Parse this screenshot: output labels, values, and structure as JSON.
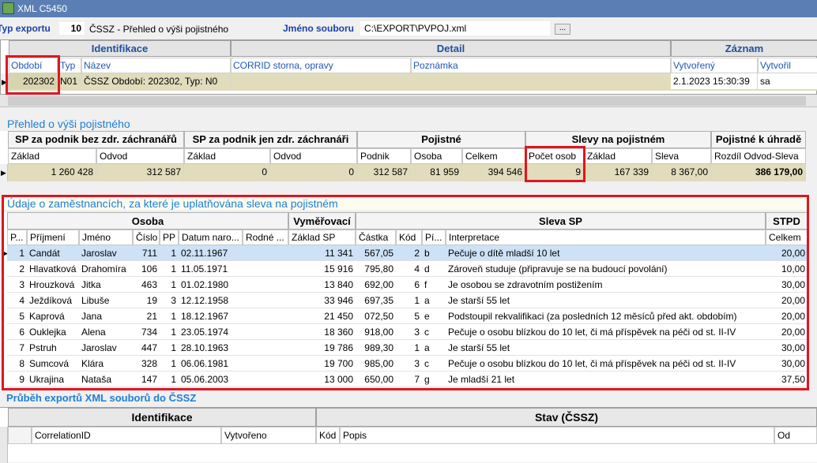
{
  "window": {
    "title": "XML C5450"
  },
  "toolbar": {
    "typ_label": "Typ exportu",
    "typ_value": "10",
    "typ_desc": "ČSSZ - Přehled o výši pojistného",
    "soubor_label": "Jméno souboru",
    "soubor_value": "C:\\EXPORT\\PVPOJ.xml",
    "browse_label": "..."
  },
  "grid1": {
    "bands": [
      "Identifikace",
      "Detail",
      "Záznam"
    ],
    "cols": [
      "Období",
      "Typ",
      "Název",
      "CORRID storna, opravy",
      "Poznámka",
      "Vytvořený",
      "Vytvořil"
    ],
    "row": {
      "obdobi": "202302",
      "typ": "N01",
      "nazev": "ČSSZ Období: 202302, Typ: N0",
      "corrid": "",
      "poznamka": "",
      "vytvoreny": "2.1.2023 15:30:39",
      "vytvoril": "sa"
    }
  },
  "prehled": {
    "title": "Přehled o výši pojistného",
    "bands": [
      "SP za podnik bez zdr. záchranářů",
      "SP za podnik jen zdr. záchranáři",
      "Pojistné",
      "Slevy na pojistném",
      "Pojistné k úhradě"
    ],
    "cols": [
      "Základ",
      "Odvod",
      "Základ",
      "Odvod",
      "Podnik",
      "Osoba",
      "Celkem",
      "Počet osob",
      "Základ",
      "Sleva",
      "Rozdíl Odvod-Sleva"
    ],
    "row": [
      "1 260 428",
      "312 587",
      "0",
      "0",
      "312 587",
      "81 959",
      "394 546",
      "9",
      "167 339",
      "8 367,00",
      "386 179,00"
    ]
  },
  "udaje": {
    "title": "Údaje o zaměstnancích, za které je uplatňována sleva na pojistném",
    "bands": [
      "Osoba",
      "Vyměřovací",
      "Sleva SP",
      "STPD"
    ],
    "cols": [
      "P...",
      "Příjmení",
      "Jméno",
      "Číslo",
      "PP",
      "Datum naro...",
      "Rodné ...",
      "Základ SP",
      "Částka",
      "Kód",
      "Pí...",
      "Interpretace",
      "Celkem"
    ],
    "rows": [
      {
        "p": "1",
        "prijmeni": "Candát",
        "jmeno": "Jaroslav",
        "cislo": "711",
        "pp": "1",
        "datum": "02.11.1967",
        "rodne": "",
        "zaklad": "11 341",
        "castka": "567,05",
        "kod": "2",
        "pi": "b",
        "interp": "Pečuje o dítě mladší 10 let",
        "celkem": "20,00"
      },
      {
        "p": "2",
        "prijmeni": "Hlavatková",
        "jmeno": "Drahomíra",
        "cislo": "106",
        "pp": "1",
        "datum": "11.05.1971",
        "rodne": "",
        "zaklad": "15 916",
        "castka": "795,80",
        "kod": "4",
        "pi": "d",
        "interp": "Zároveň studuje (připravuje se na budoucí povolání)",
        "celkem": "10,00"
      },
      {
        "p": "3",
        "prijmeni": "Hrouzková",
        "jmeno": "Jitka",
        "cislo": "463",
        "pp": "1",
        "datum": "01.02.1980",
        "rodne": "",
        "zaklad": "13 840",
        "castka": "692,00",
        "kod": "6",
        "pi": "f",
        "interp": "Je osobou se zdravotním postižením",
        "celkem": "30,00"
      },
      {
        "p": "4",
        "prijmeni": "Ježdíková",
        "jmeno": "Libuše",
        "cislo": "19",
        "pp": "3",
        "datum": "12.12.1958",
        "rodne": "",
        "zaklad": "33 946",
        "castka": "697,35",
        "kod": "1",
        "pi": "a",
        "interp": "Je starší 55 let",
        "celkem": "20,00"
      },
      {
        "p": "5",
        "prijmeni": "Kaprová",
        "jmeno": "Jana",
        "cislo": "21",
        "pp": "1",
        "datum": "18.12.1967",
        "rodne": "",
        "zaklad": "21 450",
        "castka": "072,50",
        "kod": "5",
        "pi": "e",
        "interp": "Podstoupil rekvalifikaci (za posledních 12 měsíců před akt. obdobím)",
        "celkem": "20,00"
      },
      {
        "p": "6",
        "prijmeni": "Ouklejka",
        "jmeno": "Alena",
        "cislo": "734",
        "pp": "1",
        "datum": "23.05.1974",
        "rodne": "",
        "zaklad": "18 360",
        "castka": "918,00",
        "kod": "3",
        "pi": "c",
        "interp": "Pečuje o osobu blízkou do 10 let, či má příspěvek na péči od st. II-IV",
        "celkem": "20,00"
      },
      {
        "p": "7",
        "prijmeni": "Pstruh",
        "jmeno": "Jaroslav",
        "cislo": "447",
        "pp": "1",
        "datum": "28.10.1963",
        "rodne": "",
        "zaklad": "19 786",
        "castka": "989,30",
        "kod": "1",
        "pi": "a",
        "interp": "Je starší 55 let",
        "celkem": "30,00"
      },
      {
        "p": "8",
        "prijmeni": "Sumcová",
        "jmeno": "Klára",
        "cislo": "328",
        "pp": "1",
        "datum": "06.06.1981",
        "rodne": "",
        "zaklad": "19 700",
        "castka": "985,00",
        "kod": "3",
        "pi": "c",
        "interp": "Pečuje o osobu blízkou do 10 let, či má příspěvek na péči od st. II-IV",
        "celkem": "30,00"
      },
      {
        "p": "9",
        "prijmeni": "Ukrajina",
        "jmeno": "Nataša",
        "cislo": "147",
        "pp": "1",
        "datum": "05.06.2003",
        "rodne": "",
        "zaklad": "13 000",
        "castka": "650,00",
        "kod": "7",
        "pi": "g",
        "interp": "Je mladší 21 let",
        "celkem": "37,50"
      }
    ]
  },
  "prubeh": {
    "title": "Průběh exportů XML souborů do ČSSZ",
    "bands": [
      "Identifikace",
      "Stav (ČSSZ)"
    ],
    "cols": [
      "CorrelationID",
      "Vytvořeno",
      "Kód",
      "Popis",
      "Od"
    ]
  },
  "colors": {
    "olive_row": "#e0dcbc",
    "highlight_red": "#e0151f",
    "selected_row": "#cde2f7",
    "header_blue": "#1f56b8"
  }
}
